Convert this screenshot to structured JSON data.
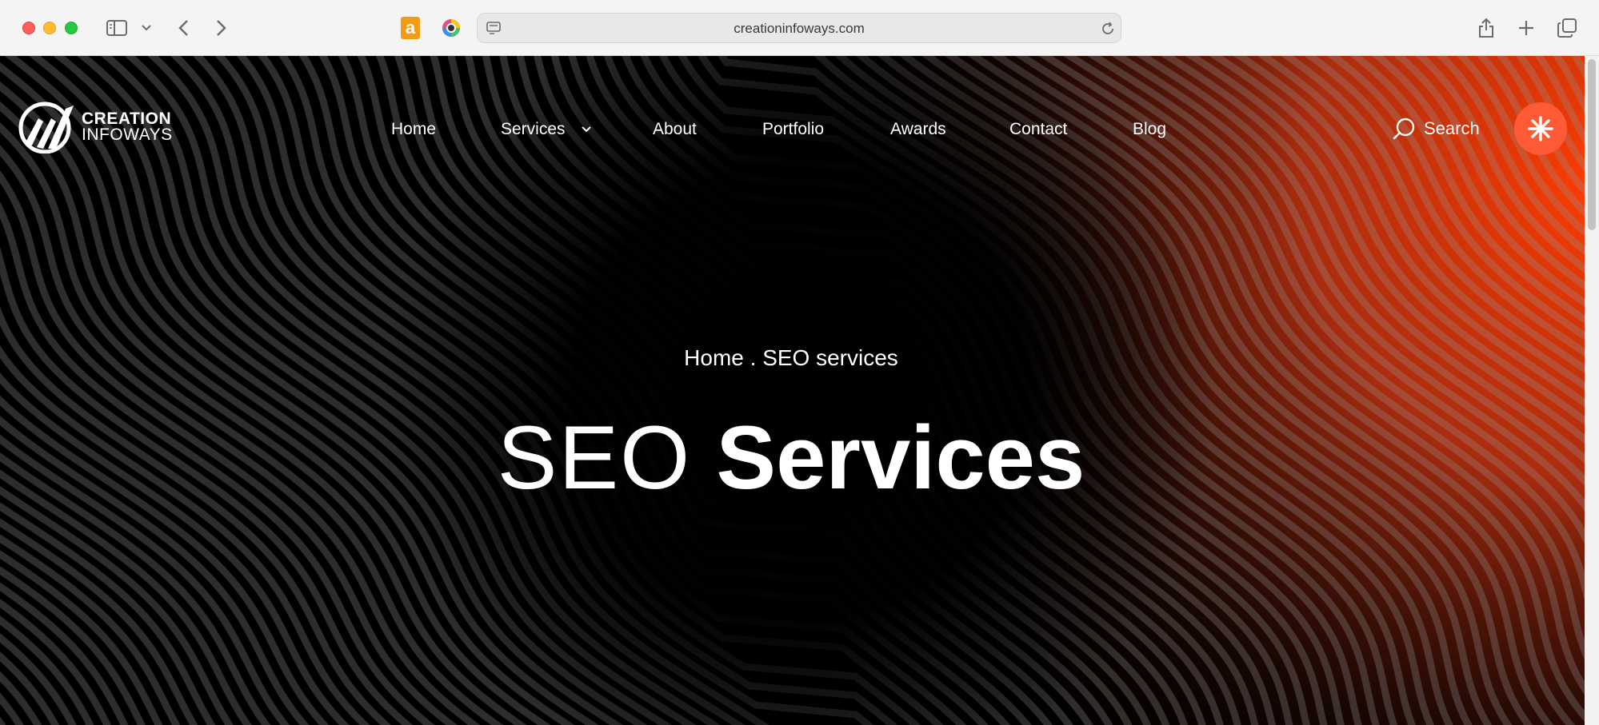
{
  "browser": {
    "url": "creationinfoways.com"
  },
  "site": {
    "logo": {
      "line1": "CREATION",
      "line2": "INFOWAYS"
    },
    "nav": [
      {
        "label": "Home"
      },
      {
        "label": "Services"
      },
      {
        "label": "About"
      },
      {
        "label": "Portfolio"
      },
      {
        "label": "Awards"
      },
      {
        "label": "Contact"
      },
      {
        "label": "Blog"
      }
    ],
    "search_label": "Search"
  },
  "hero": {
    "breadcrumb": "Home . SEO services",
    "title_light": "SEO",
    "title_bold": "Services"
  },
  "colors": {
    "accent": "#ff5a36",
    "background": "#000000",
    "glow": "#ff3c00"
  }
}
